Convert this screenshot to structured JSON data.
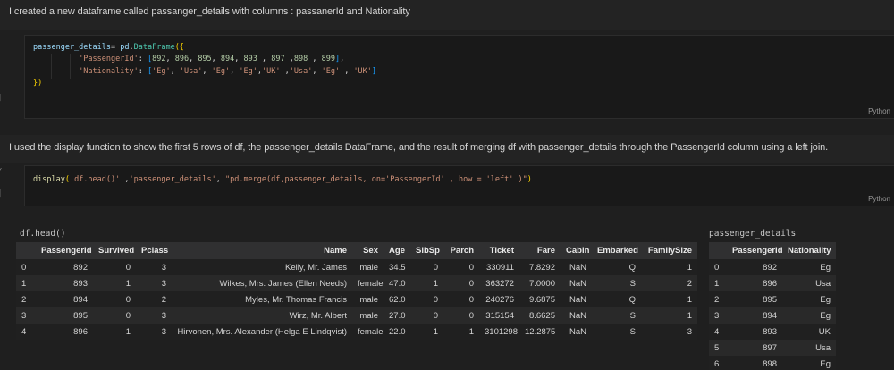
{
  "markdown_cells": [
    {
      "text": "I created a new dataframe called passanger_details with columns : passanerId and Nationality"
    },
    {
      "text": "I used the display function to show the first 5 rows of df, the passenger_details DataFrame, and the result of merging df with passenger_details through the PassengerId column using a left join."
    }
  ],
  "code_cells": [
    {
      "language_label": "Python",
      "lines": [
        [
          {
            "t": "passenger_details",
            "c": "var"
          },
          {
            "t": "= ",
            "c": "pun"
          },
          {
            "t": "pd",
            "c": "var"
          },
          {
            "t": ".",
            "c": "pun"
          },
          {
            "t": "DataFrame",
            "c": "cls"
          },
          {
            "t": "({",
            "c": "b1"
          }
        ],
        [
          {
            "t": "          ",
            "c": "pun"
          },
          {
            "t": "'PassengerId'",
            "c": "str"
          },
          {
            "t": ": ",
            "c": "pun"
          },
          {
            "t": "[",
            "c": "b2"
          },
          {
            "t": "892",
            "c": "num"
          },
          {
            "t": ", ",
            "c": "pun"
          },
          {
            "t": "896",
            "c": "num"
          },
          {
            "t": ", ",
            "c": "pun"
          },
          {
            "t": "895",
            "c": "num"
          },
          {
            "t": ", ",
            "c": "pun"
          },
          {
            "t": "894",
            "c": "num"
          },
          {
            "t": ", ",
            "c": "pun"
          },
          {
            "t": "893",
            "c": "num"
          },
          {
            "t": " , ",
            "c": "pun"
          },
          {
            "t": "897",
            "c": "num"
          },
          {
            "t": " ,",
            "c": "pun"
          },
          {
            "t": "898",
            "c": "num"
          },
          {
            "t": " , ",
            "c": "pun"
          },
          {
            "t": "899",
            "c": "num"
          },
          {
            "t": "]",
            "c": "b2"
          },
          {
            "t": ",",
            "c": "pun"
          }
        ],
        [
          {
            "t": "          ",
            "c": "pun"
          },
          {
            "t": "'Nationality'",
            "c": "str"
          },
          {
            "t": ": ",
            "c": "pun"
          },
          {
            "t": "[",
            "c": "b2"
          },
          {
            "t": "'Eg'",
            "c": "str"
          },
          {
            "t": ", ",
            "c": "pun"
          },
          {
            "t": "'Usa'",
            "c": "str"
          },
          {
            "t": ", ",
            "c": "pun"
          },
          {
            "t": "'Eg'",
            "c": "str"
          },
          {
            "t": ", ",
            "c": "pun"
          },
          {
            "t": "'Eg'",
            "c": "str"
          },
          {
            "t": ",",
            "c": "pun"
          },
          {
            "t": "'UK'",
            "c": "str"
          },
          {
            "t": " ,",
            "c": "pun"
          },
          {
            "t": "'Usa'",
            "c": "str"
          },
          {
            "t": ", ",
            "c": "pun"
          },
          {
            "t": "'Eg'",
            "c": "str"
          },
          {
            "t": " , ",
            "c": "pun"
          },
          {
            "t": "'UK'",
            "c": "str"
          },
          {
            "t": "]",
            "c": "b2"
          }
        ],
        [
          {
            "t": "})",
            "c": "b1"
          }
        ]
      ]
    },
    {
      "language_label": "Python",
      "lines": [
        [
          {
            "t": "display",
            "c": "fn"
          },
          {
            "t": "(",
            "c": "b1"
          },
          {
            "t": "'df.head()'",
            "c": "str"
          },
          {
            "t": " ,",
            "c": "pun"
          },
          {
            "t": "'passenger_details'",
            "c": "str"
          },
          {
            "t": ", ",
            "c": "pun"
          },
          {
            "t": "\"pd.merge(df,passenger_details, on='PassengerId' , how = 'left' )\"",
            "c": "str"
          },
          {
            "t": ")",
            "c": "b1"
          }
        ]
      ]
    }
  ],
  "gutter": {
    "collapse_chevron": "⌄",
    "execution_bracket": "]"
  },
  "outputs": [
    {
      "label": "df.head()",
      "columns": [
        "",
        "PassengerId",
        "Survived",
        "Pclass",
        "Name",
        "Sex",
        "Age",
        "SibSp",
        "Parch",
        "Ticket",
        "Fare",
        "Cabin",
        "Embarked",
        "FamilySize"
      ],
      "rows": [
        [
          "0",
          "892",
          "0",
          "3",
          "Kelly, Mr. James",
          "male",
          "34.5",
          "0",
          "0",
          "330911",
          "7.8292",
          "NaN",
          "Q",
          "1"
        ],
        [
          "1",
          "893",
          "1",
          "3",
          "Wilkes, Mrs. James (Ellen Needs)",
          "female",
          "47.0",
          "1",
          "0",
          "363272",
          "7.0000",
          "NaN",
          "S",
          "2"
        ],
        [
          "2",
          "894",
          "0",
          "2",
          "Myles, Mr. Thomas Francis",
          "male",
          "62.0",
          "0",
          "0",
          "240276",
          "9.6875",
          "NaN",
          "Q",
          "1"
        ],
        [
          "3",
          "895",
          "0",
          "3",
          "Wirz, Mr. Albert",
          "male",
          "27.0",
          "0",
          "0",
          "315154",
          "8.6625",
          "NaN",
          "S",
          "1"
        ],
        [
          "4",
          "896",
          "1",
          "3",
          "Hirvonen, Mrs. Alexander (Helga E Lindqvist)",
          "female",
          "22.0",
          "1",
          "1",
          "3101298",
          "12.2875",
          "NaN",
          "S",
          "3"
        ]
      ]
    },
    {
      "label": "passenger_details",
      "columns": [
        "",
        "PassengerId",
        "Nationality"
      ],
      "rows": [
        [
          "0",
          "892",
          "Eg"
        ],
        [
          "1",
          "896",
          "Usa"
        ],
        [
          "2",
          "895",
          "Eg"
        ],
        [
          "3",
          "894",
          "Eg"
        ],
        [
          "4",
          "893",
          "UK"
        ],
        [
          "5",
          "897",
          "Usa"
        ],
        [
          "6",
          "898",
          "Eg"
        ]
      ]
    }
  ],
  "colors": {
    "background": "#1f1f1f",
    "code_cell_background": "#191919",
    "string": "#CE9178",
    "number": "#B5CEA8",
    "variable": "#9CDCFE",
    "class": "#4EC9B0",
    "function": "#DCDCAA",
    "bracket_gold": "#FFD700",
    "bracket_blue": "#179FFF"
  }
}
